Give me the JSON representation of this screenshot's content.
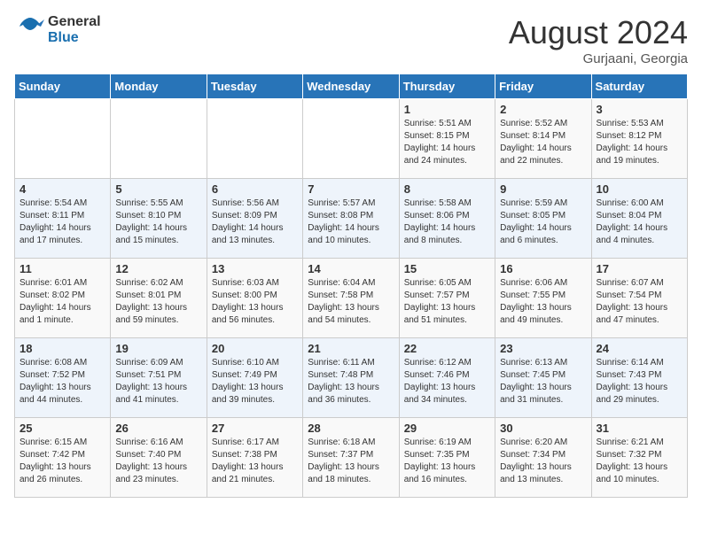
{
  "header": {
    "logo_general": "General",
    "logo_blue": "Blue",
    "title": "August 2024",
    "location": "Gurjaani, Georgia"
  },
  "days_of_week": [
    "Sunday",
    "Monday",
    "Tuesday",
    "Wednesday",
    "Thursday",
    "Friday",
    "Saturday"
  ],
  "weeks": [
    [
      {
        "day": "",
        "info": ""
      },
      {
        "day": "",
        "info": ""
      },
      {
        "day": "",
        "info": ""
      },
      {
        "day": "",
        "info": ""
      },
      {
        "day": "1",
        "info": "Sunrise: 5:51 AM\nSunset: 8:15 PM\nDaylight: 14 hours\nand 24 minutes."
      },
      {
        "day": "2",
        "info": "Sunrise: 5:52 AM\nSunset: 8:14 PM\nDaylight: 14 hours\nand 22 minutes."
      },
      {
        "day": "3",
        "info": "Sunrise: 5:53 AM\nSunset: 8:12 PM\nDaylight: 14 hours\nand 19 minutes."
      }
    ],
    [
      {
        "day": "4",
        "info": "Sunrise: 5:54 AM\nSunset: 8:11 PM\nDaylight: 14 hours\nand 17 minutes."
      },
      {
        "day": "5",
        "info": "Sunrise: 5:55 AM\nSunset: 8:10 PM\nDaylight: 14 hours\nand 15 minutes."
      },
      {
        "day": "6",
        "info": "Sunrise: 5:56 AM\nSunset: 8:09 PM\nDaylight: 14 hours\nand 13 minutes."
      },
      {
        "day": "7",
        "info": "Sunrise: 5:57 AM\nSunset: 8:08 PM\nDaylight: 14 hours\nand 10 minutes."
      },
      {
        "day": "8",
        "info": "Sunrise: 5:58 AM\nSunset: 8:06 PM\nDaylight: 14 hours\nand 8 minutes."
      },
      {
        "day": "9",
        "info": "Sunrise: 5:59 AM\nSunset: 8:05 PM\nDaylight: 14 hours\nand 6 minutes."
      },
      {
        "day": "10",
        "info": "Sunrise: 6:00 AM\nSunset: 8:04 PM\nDaylight: 14 hours\nand 4 minutes."
      }
    ],
    [
      {
        "day": "11",
        "info": "Sunrise: 6:01 AM\nSunset: 8:02 PM\nDaylight: 14 hours\nand 1 minute."
      },
      {
        "day": "12",
        "info": "Sunrise: 6:02 AM\nSunset: 8:01 PM\nDaylight: 13 hours\nand 59 minutes."
      },
      {
        "day": "13",
        "info": "Sunrise: 6:03 AM\nSunset: 8:00 PM\nDaylight: 13 hours\nand 56 minutes."
      },
      {
        "day": "14",
        "info": "Sunrise: 6:04 AM\nSunset: 7:58 PM\nDaylight: 13 hours\nand 54 minutes."
      },
      {
        "day": "15",
        "info": "Sunrise: 6:05 AM\nSunset: 7:57 PM\nDaylight: 13 hours\nand 51 minutes."
      },
      {
        "day": "16",
        "info": "Sunrise: 6:06 AM\nSunset: 7:55 PM\nDaylight: 13 hours\nand 49 minutes."
      },
      {
        "day": "17",
        "info": "Sunrise: 6:07 AM\nSunset: 7:54 PM\nDaylight: 13 hours\nand 47 minutes."
      }
    ],
    [
      {
        "day": "18",
        "info": "Sunrise: 6:08 AM\nSunset: 7:52 PM\nDaylight: 13 hours\nand 44 minutes."
      },
      {
        "day": "19",
        "info": "Sunrise: 6:09 AM\nSunset: 7:51 PM\nDaylight: 13 hours\nand 41 minutes."
      },
      {
        "day": "20",
        "info": "Sunrise: 6:10 AM\nSunset: 7:49 PM\nDaylight: 13 hours\nand 39 minutes."
      },
      {
        "day": "21",
        "info": "Sunrise: 6:11 AM\nSunset: 7:48 PM\nDaylight: 13 hours\nand 36 minutes."
      },
      {
        "day": "22",
        "info": "Sunrise: 6:12 AM\nSunset: 7:46 PM\nDaylight: 13 hours\nand 34 minutes."
      },
      {
        "day": "23",
        "info": "Sunrise: 6:13 AM\nSunset: 7:45 PM\nDaylight: 13 hours\nand 31 minutes."
      },
      {
        "day": "24",
        "info": "Sunrise: 6:14 AM\nSunset: 7:43 PM\nDaylight: 13 hours\nand 29 minutes."
      }
    ],
    [
      {
        "day": "25",
        "info": "Sunrise: 6:15 AM\nSunset: 7:42 PM\nDaylight: 13 hours\nand 26 minutes."
      },
      {
        "day": "26",
        "info": "Sunrise: 6:16 AM\nSunset: 7:40 PM\nDaylight: 13 hours\nand 23 minutes."
      },
      {
        "day": "27",
        "info": "Sunrise: 6:17 AM\nSunset: 7:38 PM\nDaylight: 13 hours\nand 21 minutes."
      },
      {
        "day": "28",
        "info": "Sunrise: 6:18 AM\nSunset: 7:37 PM\nDaylight: 13 hours\nand 18 minutes."
      },
      {
        "day": "29",
        "info": "Sunrise: 6:19 AM\nSunset: 7:35 PM\nDaylight: 13 hours\nand 16 minutes."
      },
      {
        "day": "30",
        "info": "Sunrise: 6:20 AM\nSunset: 7:34 PM\nDaylight: 13 hours\nand 13 minutes."
      },
      {
        "day": "31",
        "info": "Sunrise: 6:21 AM\nSunset: 7:32 PM\nDaylight: 13 hours\nand 10 minutes."
      }
    ]
  ]
}
